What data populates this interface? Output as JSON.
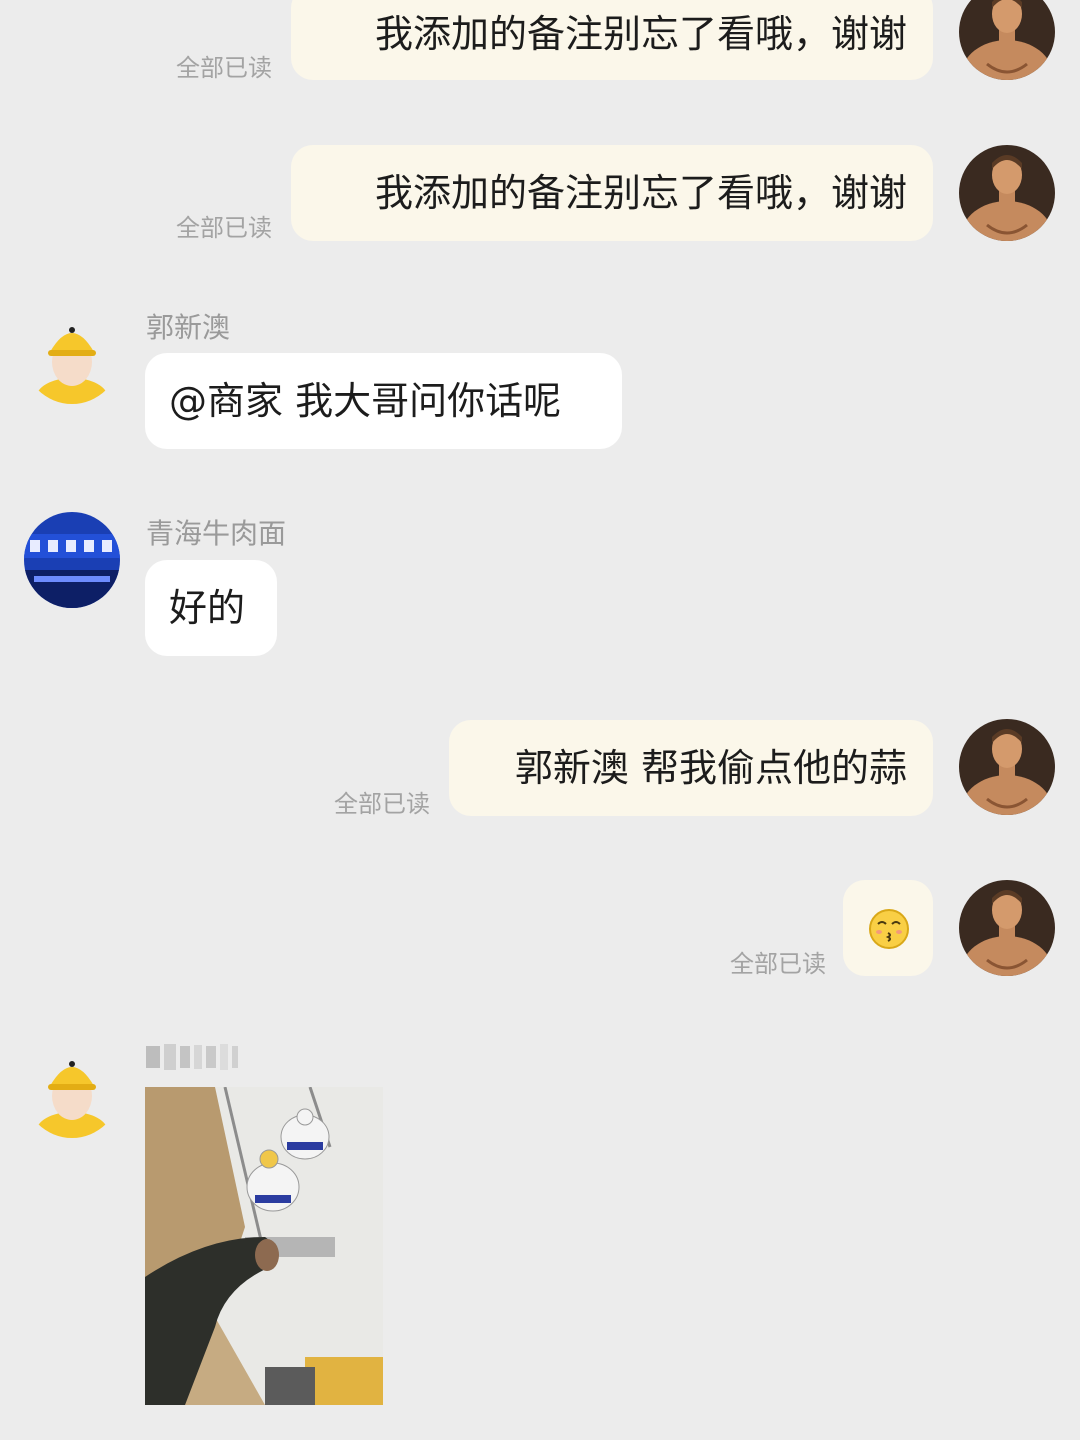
{
  "colors": {
    "background": "#ececec",
    "bubble_outgoing": "#fbf7ea",
    "bubble_incoming": "#ffffff",
    "status_text": "#a3a3a3",
    "sender_text": "#9a9a9a",
    "avatar_yellow": "#f6c72b"
  },
  "messages": [
    {
      "direction": "outgoing",
      "text": "我添加的备注别忘了看哦，谢谢",
      "status": "全部已读",
      "avatar": "shirtless-man-avatar"
    },
    {
      "direction": "outgoing",
      "text": "我添加的备注别忘了看哦，谢谢",
      "status": "全部已读",
      "avatar": "shirtless-man-avatar"
    },
    {
      "direction": "incoming",
      "sender": "郭新澳",
      "text": "@商家 我大哥问你话呢",
      "avatar": "yellow-helmet-avatar"
    },
    {
      "direction": "incoming",
      "sender": "青海牛肉面",
      "text": "好的",
      "avatar": "shop-sign-avatar"
    },
    {
      "direction": "outgoing",
      "text": "郭新澳 帮我偷点他的蒜",
      "status": "全部已读",
      "avatar": "shirtless-man-avatar"
    },
    {
      "direction": "outgoing",
      "emoji": "kissing-face-icon",
      "status": "全部已读",
      "avatar": "shirtless-man-avatar"
    },
    {
      "direction": "incoming",
      "sender_redacted": true,
      "image": "photo-hand-taking-condiment-bottles",
      "avatar": "yellow-helmet-avatar"
    }
  ]
}
